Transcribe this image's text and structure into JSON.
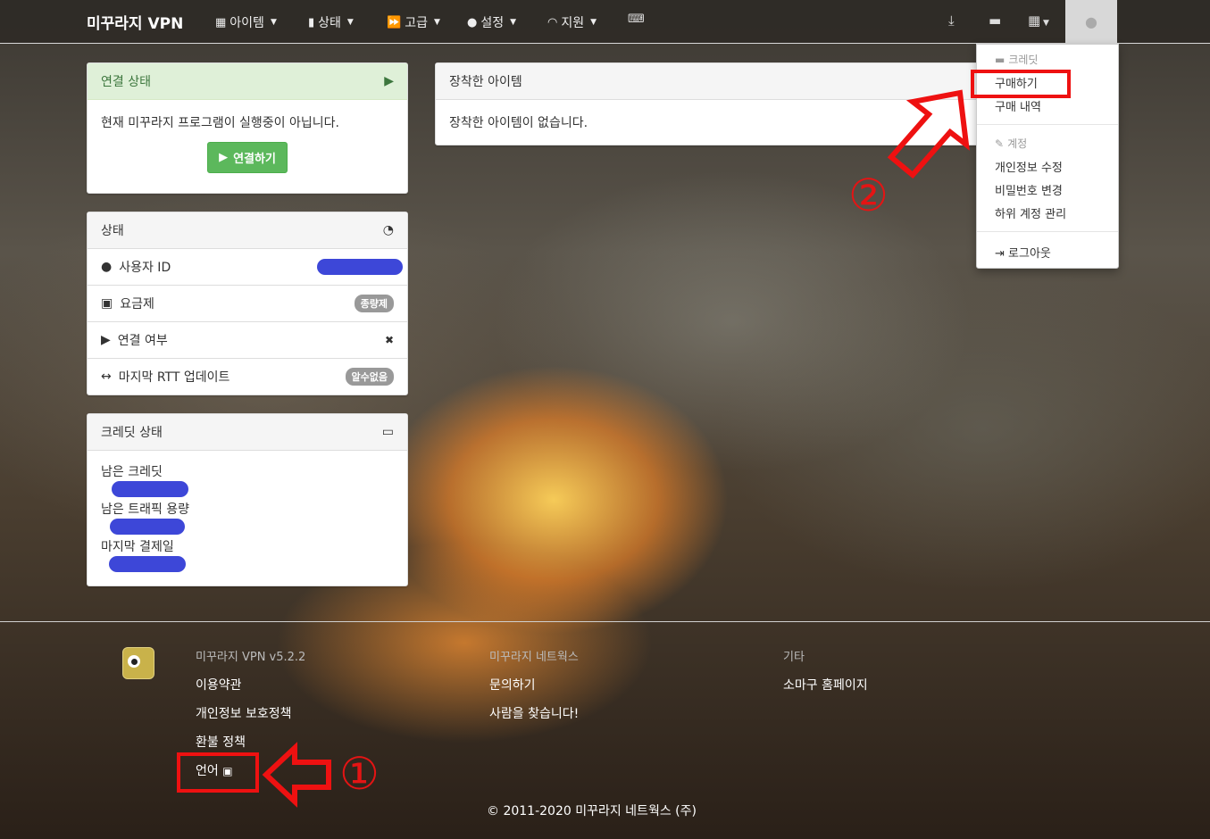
{
  "navbar": {
    "brand": "미꾸라지 VPN",
    "items": [
      {
        "label": "아이템",
        "icon": "gift-icon"
      },
      {
        "label": "상태",
        "icon": "bar-chart-icon"
      },
      {
        "label": "고급",
        "icon": "fast-forward-icon"
      },
      {
        "label": "설정",
        "icon": "user-icon"
      },
      {
        "label": "지원",
        "icon": "headphones-icon"
      }
    ],
    "right_icons": [
      "keyboard-icon",
      "download-icon",
      "chat-icon",
      "grid-icon",
      "user-icon"
    ]
  },
  "connection_panel": {
    "title": "연결 상태",
    "message": "현재 미꾸라지 프로그램이 실행중이 아닙니다.",
    "connect_button": "연결하기"
  },
  "status_panel": {
    "title": "상태",
    "rows": [
      {
        "label": "사용자 ID",
        "icon": "user-icon"
      },
      {
        "label": "요금제",
        "icon": "money-icon",
        "badge": "종량제"
      },
      {
        "label": "연결 여부",
        "icon": "play-icon",
        "value": "✖"
      },
      {
        "label": "마지막 RTT 업데이트",
        "icon": "arrows-icon",
        "badge": "알수없음"
      }
    ]
  },
  "credit_panel": {
    "title": "크레딧 상태",
    "lines": [
      "남은 크레딧",
      "남은 트래픽 용량",
      "마지막 결제일"
    ]
  },
  "items_panel": {
    "title": "장착한 아이템",
    "message": "장착한 아이템이 없습니다."
  },
  "dropdown": {
    "credit_header": "크레딧",
    "buy": "구매하기",
    "history": "구매 내역",
    "account_header": "계정",
    "edit_profile": "개인정보 수정",
    "change_password": "비밀번호 변경",
    "sub_accounts": "하위 계정 관리",
    "logout": "로그아웃"
  },
  "footer": {
    "version": "미꾸라지 VPN v5.2.2",
    "col1": [
      "이용약관",
      "개인정보 보호정책",
      "환불 정책",
      "언어"
    ],
    "col2_head": "미꾸라지 네트웍스",
    "col2": [
      "문의하기",
      "사람을 찾습니다!"
    ],
    "col3_head": "기타",
    "col3": [
      "소마구 홈페이지"
    ],
    "copyright": "© 2011-2020 미꾸라지 네트웍스 (주)"
  },
  "annotations": {
    "step1": "①",
    "step2": "②",
    "highlight_color": "#ee1111"
  }
}
